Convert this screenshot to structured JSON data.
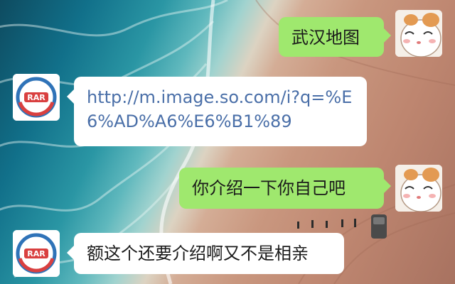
{
  "chat": {
    "messages": [
      {
        "side": "right",
        "type": "text",
        "text": "武汉地图"
      },
      {
        "side": "left",
        "type": "link",
        "text": "http://m.image.so.com/i?q=%E6%AD%A6%E6%B1%89"
      },
      {
        "side": "right",
        "type": "text",
        "text": "你介绍一下你自己吧"
      },
      {
        "side": "left",
        "type": "text",
        "text": "额这个还要介绍啊又不是相亲"
      }
    ]
  },
  "avatars": {
    "bot_icon": "bot-logo-icon",
    "user_icon": "cartoon-hamster-icon"
  },
  "colors": {
    "user_bubble": "#9fe86e",
    "bot_bubble": "#ffffff",
    "link": "#4a6fa8",
    "bot_logo_blue": "#2f73b8",
    "bot_logo_red": "#d94040"
  }
}
